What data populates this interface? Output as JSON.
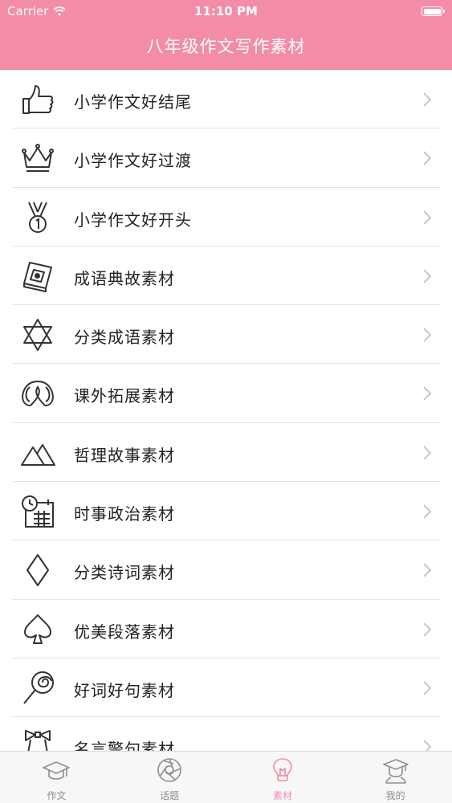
{
  "status_bar": {
    "carrier": "Carrier",
    "time": "11:10 PM"
  },
  "nav": {
    "title": "八年级作文写作素材"
  },
  "list": {
    "items": [
      {
        "label": "小学作文好结尾",
        "icon": "thumbs-up-icon"
      },
      {
        "label": "小学作文好过渡",
        "icon": "crown-icon"
      },
      {
        "label": "小学作文好开头",
        "icon": "medal-icon"
      },
      {
        "label": "成语典故素材",
        "icon": "book-icon"
      },
      {
        "label": "分类成语素材",
        "icon": "star-of-david-icon"
      },
      {
        "label": "课外拓展素材",
        "icon": "pretzel-icon"
      },
      {
        "label": "哲理故事素材",
        "icon": "mountains-icon"
      },
      {
        "label": "时事政治素材",
        "icon": "calendar-clock-icon"
      },
      {
        "label": "分类诗词素材",
        "icon": "diamond-icon"
      },
      {
        "label": "优美段落素材",
        "icon": "spade-icon"
      },
      {
        "label": "好词好句素材",
        "icon": "lollipop-icon"
      },
      {
        "label": "名言警句素材",
        "icon": "bow-icon"
      }
    ]
  },
  "tabbar": {
    "tabs": [
      {
        "label": "作文",
        "icon": "graduation-cap-icon"
      },
      {
        "label": "话题",
        "icon": "aperture-icon"
      },
      {
        "label": "素材",
        "icon": "lightbulb-icon"
      },
      {
        "label": "我的",
        "icon": "graduate-avatar-icon"
      }
    ],
    "active_index": 2
  },
  "colors": {
    "accent": "#f38ca6",
    "separator": "#e3e3e3",
    "chevron": "#c7c7cc"
  }
}
